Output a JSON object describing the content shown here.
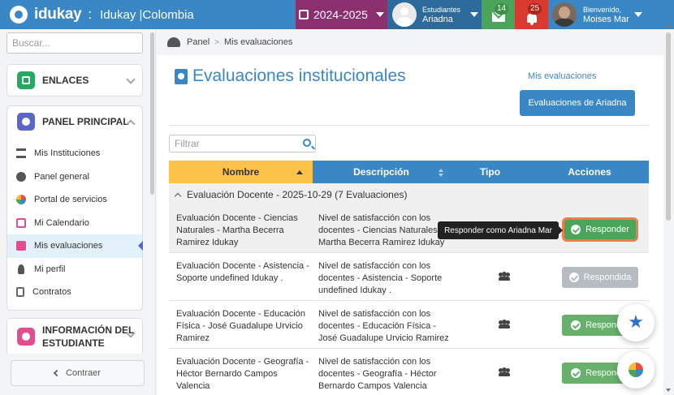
{
  "header": {
    "brand": "idukay",
    "separator": ":",
    "institution": "Idukay |Colombia",
    "year": "2024-2025",
    "students_label": "Estudiantes",
    "student_name": "Ariadna",
    "messages_count": "14",
    "notifications_count": "25",
    "welcome_label": "Bienvenido,",
    "user_name": "Moises Mar"
  },
  "sidebar": {
    "search_placeholder": "Buscar...",
    "links_title": "ENLACES",
    "main_panel_title": "PANEL PRINCIPAL",
    "items": [
      {
        "label": "Mis Instituciones"
      },
      {
        "label": "Panel general"
      },
      {
        "label": "Portal de servicios"
      },
      {
        "label": "Mi Calendario"
      },
      {
        "label": "Mis evaluaciones"
      },
      {
        "label": "Mi perfil"
      },
      {
        "label": "Contratos"
      }
    ],
    "student_info_title_1": "INFORMACIÓN DEL",
    "student_info_title_2": "ESTUDIANTE",
    "collapse_label": "Contraer"
  },
  "breadcrumb": {
    "root": "Panel",
    "current": "Mis evaluaciones"
  },
  "page": {
    "title": "Evaluaciones institucionales",
    "my_evaluations_link": "Mis evaluaciones",
    "ariadna_button": "Evaluaciones de Ariadna",
    "filter_placeholder": "Filtrar"
  },
  "table": {
    "headers": {
      "name": "Nombre",
      "description": "Descripción",
      "type": "Tipo",
      "actions": "Acciones"
    },
    "group_label": "Evaluación Docente - 2025-10-29 (7 Evaluaciones)",
    "tooltip": "Responder como Ariadna Mar",
    "rows": [
      {
        "name": "Evaluación Docente - Ciencias Naturales - Martha Becerra Ramirez Idukay",
        "description": "Nivel de satisfacción con los docentes - Ciencias Naturales - Martha Becerra Ramirez Idukay",
        "action": "Responder"
      },
      {
        "name": "Evaluación Docente - Asistencia - Soporte undefined Idukay .",
        "description": "Nivel de satisfacción con los docentes - Asistencia - Soporte undefined Idukay .",
        "action": "Respondida"
      },
      {
        "name": "Evaluación Docente - Educación Física - José Guadalupe Urvicio Ramirez",
        "description": "Nivel de satisfacción con los docentes - Educación Física - José Guadalupe Urvicio Ramirez",
        "action": "Responder"
      },
      {
        "name": "Evaluación Docente - Geografía - Héctor Bernardo Campos Valencia",
        "description": "Nivel de satisfacción con los docentes - Geografía - Héctor Bernardo Campos Valencia",
        "action": "Responder"
      }
    ]
  },
  "icons": {
    "star": "★"
  },
  "colors": {
    "primary": "#3a87c6",
    "year_bg": "#8b2f6f",
    "success": "#4aa55a",
    "danger": "#d83a2f",
    "sorted_header": "#fdc24a",
    "focus_ring": "#ec7d4e"
  }
}
